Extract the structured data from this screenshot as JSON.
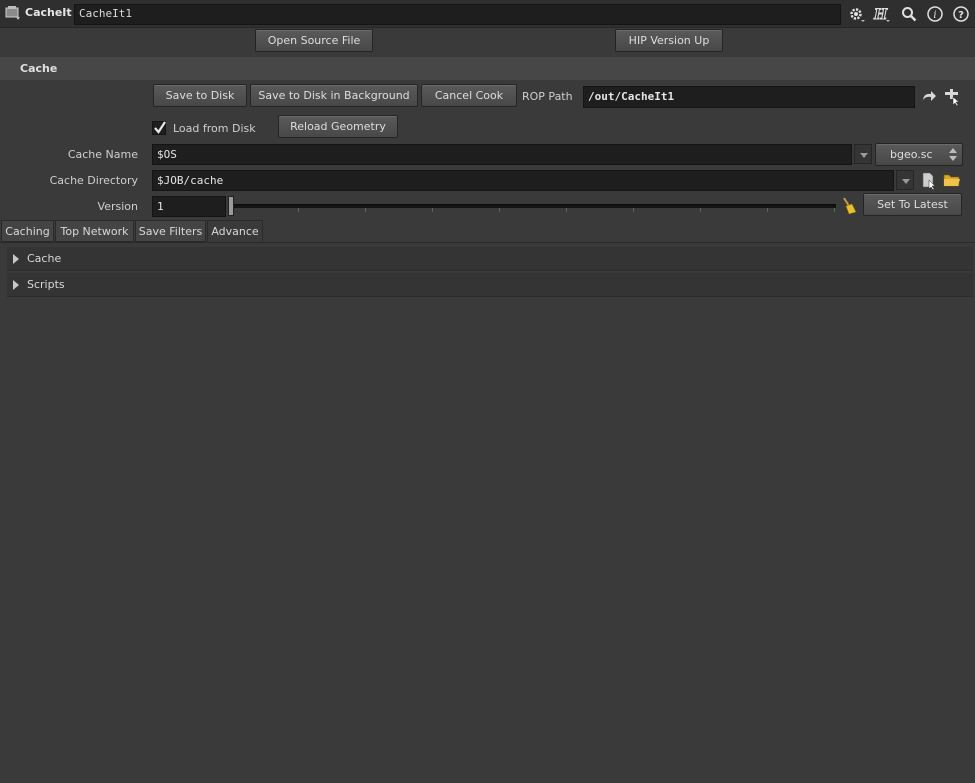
{
  "header": {
    "node_type": "CacheIt",
    "node_name": "CacheIt1"
  },
  "top_buttons": {
    "open_source": "Open Source File",
    "hip_version_up": "HIP Version Up"
  },
  "section": {
    "title": "Cache"
  },
  "actions": {
    "save_to_disk": "Save to Disk",
    "save_bg": "Save to Disk in Background",
    "cancel_cook": "Cancel Cook",
    "rop_label": "ROP Path",
    "rop_value": "/out/CacheIt1"
  },
  "load": {
    "label": "Load from Disk",
    "checked": true,
    "reload": "Reload Geometry"
  },
  "cache_name": {
    "label": "Cache Name",
    "value": "$OS",
    "format": "bgeo.sc"
  },
  "cache_dir": {
    "label": "Cache Directory",
    "value": "$JOB/cache"
  },
  "version": {
    "label": "Version",
    "value": "1",
    "set_latest": "Set To Latest"
  },
  "tabs": [
    {
      "label": "Caching"
    },
    {
      "label": "Top Network"
    },
    {
      "label": "Save Filters"
    },
    {
      "label": "Advance"
    }
  ],
  "active_tab": "Advance",
  "folders": [
    {
      "label": "Cache"
    },
    {
      "label": "Scripts"
    }
  ]
}
